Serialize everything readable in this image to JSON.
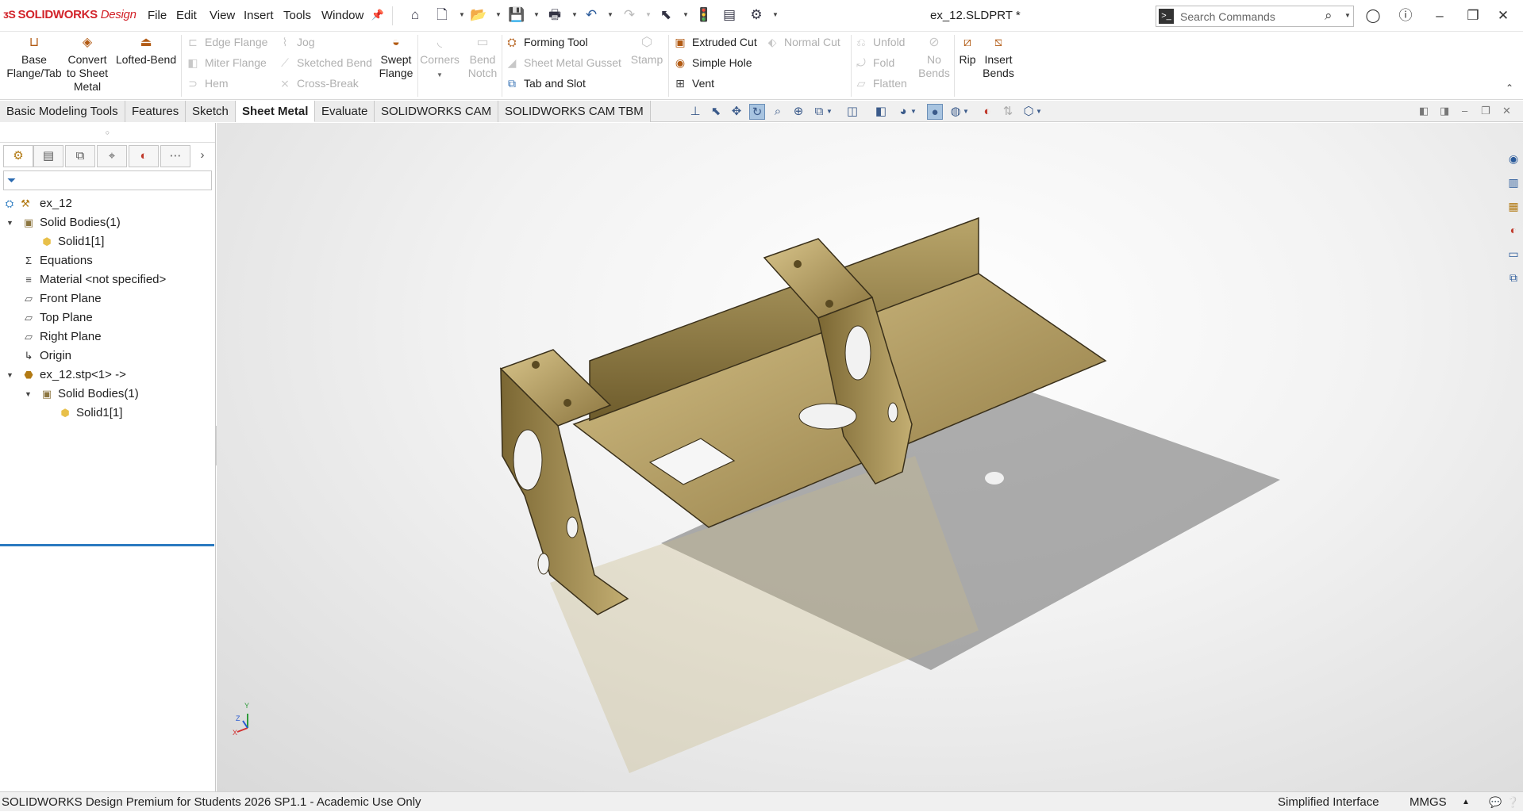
{
  "app": {
    "logo_brand": "SOLIDWORKS",
    "logo_design": "Design",
    "document_title": "ex_12.SLDPRT *"
  },
  "menu": [
    "File",
    "Edit",
    "View",
    "Insert",
    "Tools",
    "Window"
  ],
  "search": {
    "placeholder": "Search Commands"
  },
  "ribbon": {
    "base_flange": [
      "Base",
      "Flange/Tab"
    ],
    "convert": [
      "Convert",
      "to Sheet",
      "Metal"
    ],
    "lofted_bend": "Lofted-Bend",
    "edge_flange": "Edge Flange",
    "jog": "Jog",
    "miter_flange": "Miter Flange",
    "sketched_bend": "Sketched Bend",
    "hem": "Hem",
    "cross_break": "Cross-Break",
    "swept_flange": [
      "Swept",
      "Flange"
    ],
    "corners": "Corners",
    "bend_notch": [
      "Bend",
      "Notch"
    ],
    "forming_tool": "Forming Tool",
    "sheet_metal_gusset": "Sheet Metal Gusset",
    "stamp": "Stamp",
    "tab_and_slot": "Tab and Slot",
    "extruded_cut": "Extruded Cut",
    "normal_cut": "Normal Cut",
    "simple_hole": "Simple Hole",
    "vent": "Vent",
    "unfold": "Unfold",
    "fold": "Fold",
    "flatten": "Flatten",
    "no_bends": [
      "No",
      "Bends"
    ],
    "rip": "Rip",
    "insert_bends": [
      "Insert",
      "Bends"
    ]
  },
  "tabs": [
    "Basic Modeling Tools",
    "Features",
    "Sketch",
    "Sheet Metal",
    "Evaluate",
    "SOLIDWORKS CAM",
    "SOLIDWORKS CAM TBM"
  ],
  "active_tab": "Sheet Metal",
  "tree": [
    {
      "label": "ex_12",
      "level": 0,
      "expander": "",
      "icon": "part-icon"
    },
    {
      "label": "Solid Bodies(1)",
      "level": 0,
      "expander": "▼",
      "icon": "folder-icon"
    },
    {
      "label": "Solid1[1]",
      "level": 1,
      "expander": "",
      "icon": "solid-body-icon"
    },
    {
      "label": "Equations",
      "level": 0,
      "expander": "",
      "icon": "equations-icon"
    },
    {
      "label": "Material <not specified>",
      "level": 0,
      "expander": "",
      "icon": "material-icon"
    },
    {
      "label": "Front Plane",
      "level": 0,
      "expander": "",
      "icon": "plane-icon"
    },
    {
      "label": "Top Plane",
      "level": 0,
      "expander": "",
      "icon": "plane-icon"
    },
    {
      "label": "Right Plane",
      "level": 0,
      "expander": "",
      "icon": "plane-icon"
    },
    {
      "label": "Origin",
      "level": 0,
      "expander": "",
      "icon": "origin-icon"
    },
    {
      "label": "ex_12.stp<1> ->",
      "level": 0,
      "expander": "▼",
      "icon": "imported-icon"
    },
    {
      "label": "Solid Bodies(1)",
      "level": 1,
      "expander": "▼",
      "icon": "folder-icon"
    },
    {
      "label": "Solid1[1]",
      "level": 2,
      "expander": "",
      "icon": "solid-body-icon"
    }
  ],
  "status": {
    "left": "SOLIDWORKS Design Premium for Students 2026 SP1.1 - Academic Use Only",
    "interface": "Simplified Interface",
    "units": "MMGS"
  },
  "triad": {
    "x": "X",
    "y": "Y",
    "z": "Z"
  },
  "colors": {
    "brand_red": "#d2232a",
    "part_gold": "#a4925a",
    "selection_blue": "#2a7ac0"
  }
}
